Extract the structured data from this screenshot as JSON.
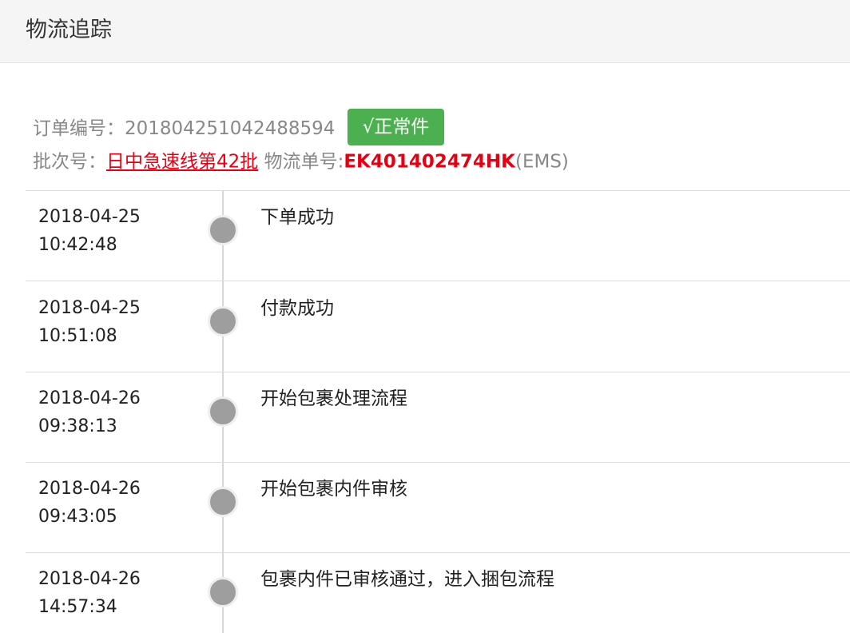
{
  "header": {
    "title": "物流追踪"
  },
  "order": {
    "number_label": "订单编号：",
    "number": "201804251042488594",
    "status_label": "√正常件",
    "batch_label": "批次号：",
    "batch_value": "日中急速线第42批",
    "tracking_label": "物流单号:",
    "tracking_number": "EK401402474HK",
    "carrier": "(EMS)"
  },
  "timeline": {
    "events": [
      {
        "date": "2018-04-25",
        "time": "10:42:48",
        "description": "下单成功"
      },
      {
        "date": "2018-04-25",
        "time": "10:51:08",
        "description": "付款成功"
      },
      {
        "date": "2018-04-26",
        "time": "09:38:13",
        "description": "开始包裹处理流程"
      },
      {
        "date": "2018-04-26",
        "time": "09:43:05",
        "description": "开始包裹内件审核"
      },
      {
        "date": "2018-04-26",
        "time": "14:57:34",
        "description": "包裹内件已审核通过，进入捆包流程"
      }
    ]
  },
  "colors": {
    "accent_green": "#4caf50",
    "highlight_red": "#e60012",
    "timeline_dot": "#9e9e9e"
  }
}
